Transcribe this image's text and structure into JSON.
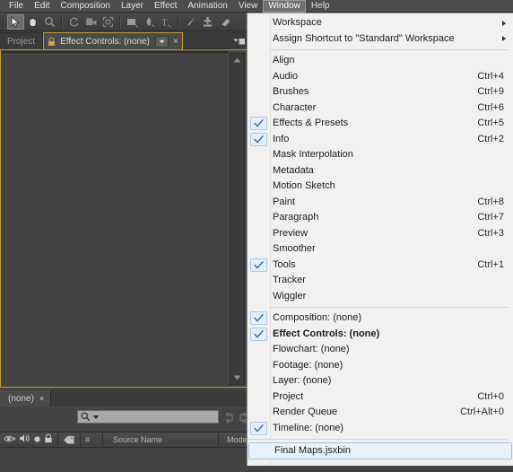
{
  "app": {
    "menubar": [
      {
        "label": "File",
        "active": false
      },
      {
        "label": "Edit",
        "active": false
      },
      {
        "label": "Composition",
        "active": false
      },
      {
        "label": "Layer",
        "active": false
      },
      {
        "label": "Effect",
        "active": false
      },
      {
        "label": "Animation",
        "active": false
      },
      {
        "label": "View",
        "active": false
      },
      {
        "label": "Window",
        "active": true
      },
      {
        "label": "Help",
        "active": false
      }
    ],
    "toolbar": {
      "tools": [
        {
          "name": "selection-tool",
          "selected": true
        },
        {
          "name": "hand-tool",
          "selected": false
        },
        {
          "name": "zoom-tool",
          "selected": false
        },
        {
          "name": "rotation-tool",
          "selected": false
        },
        {
          "name": "camera-tool",
          "selected": false
        },
        {
          "name": "pan-behind-tool",
          "selected": false
        },
        {
          "name": "shape-tool",
          "selected": false
        },
        {
          "name": "pen-tool",
          "selected": false
        },
        {
          "name": "text-tool",
          "selected": false
        },
        {
          "name": "brush-tool",
          "selected": false
        },
        {
          "name": "clone-stamp-tool",
          "selected": false
        },
        {
          "name": "eraser-tool",
          "selected": false
        }
      ]
    }
  },
  "panels": {
    "tabs": [
      {
        "label": "Project",
        "active": false
      },
      {
        "label": "Effect Controls: (none)",
        "active": true
      }
    ],
    "close_glyph": "×",
    "timeline": {
      "tab_label": "(none)",
      "search_value": "",
      "search_placeholder": "",
      "columns": [
        "Source Name",
        "Mode"
      ],
      "number_column": "#"
    }
  },
  "window_menu": {
    "groups": [
      {
        "items": [
          {
            "label": "Workspace",
            "shortcut": "",
            "checked": false,
            "submenu": true,
            "bold": false,
            "highlight": false
          },
          {
            "label": "Assign Shortcut to \"Standard\" Workspace",
            "shortcut": "",
            "checked": false,
            "submenu": true,
            "bold": false,
            "highlight": false
          }
        ]
      },
      {
        "items": [
          {
            "label": "Align",
            "shortcut": "",
            "checked": false,
            "submenu": false,
            "bold": false,
            "highlight": false
          },
          {
            "label": "Audio",
            "shortcut": "Ctrl+4",
            "checked": false,
            "submenu": false,
            "bold": false,
            "highlight": false
          },
          {
            "label": "Brushes",
            "shortcut": "Ctrl+9",
            "checked": false,
            "submenu": false,
            "bold": false,
            "highlight": false
          },
          {
            "label": "Character",
            "shortcut": "Ctrl+6",
            "checked": false,
            "submenu": false,
            "bold": false,
            "highlight": false
          },
          {
            "label": "Effects & Presets",
            "shortcut": "Ctrl+5",
            "checked": true,
            "submenu": false,
            "bold": false,
            "highlight": false
          },
          {
            "label": "Info",
            "shortcut": "Ctrl+2",
            "checked": true,
            "submenu": false,
            "bold": false,
            "highlight": false
          },
          {
            "label": "Mask Interpolation",
            "shortcut": "",
            "checked": false,
            "submenu": false,
            "bold": false,
            "highlight": false
          },
          {
            "label": "Metadata",
            "shortcut": "",
            "checked": false,
            "submenu": false,
            "bold": false,
            "highlight": false
          },
          {
            "label": "Motion Sketch",
            "shortcut": "",
            "checked": false,
            "submenu": false,
            "bold": false,
            "highlight": false
          },
          {
            "label": "Paint",
            "shortcut": "Ctrl+8",
            "checked": false,
            "submenu": false,
            "bold": false,
            "highlight": false
          },
          {
            "label": "Paragraph",
            "shortcut": "Ctrl+7",
            "checked": false,
            "submenu": false,
            "bold": false,
            "highlight": false
          },
          {
            "label": "Preview",
            "shortcut": "Ctrl+3",
            "checked": false,
            "submenu": false,
            "bold": false,
            "highlight": false
          },
          {
            "label": "Smoother",
            "shortcut": "",
            "checked": false,
            "submenu": false,
            "bold": false,
            "highlight": false
          },
          {
            "label": "Tools",
            "shortcut": "Ctrl+1",
            "checked": true,
            "submenu": false,
            "bold": false,
            "highlight": false
          },
          {
            "label": "Tracker",
            "shortcut": "",
            "checked": false,
            "submenu": false,
            "bold": false,
            "highlight": false
          },
          {
            "label": "Wiggler",
            "shortcut": "",
            "checked": false,
            "submenu": false,
            "bold": false,
            "highlight": false
          }
        ]
      },
      {
        "items": [
          {
            "label": "Composition: (none)",
            "shortcut": "",
            "checked": true,
            "submenu": false,
            "bold": false,
            "highlight": false
          },
          {
            "label": "Effect Controls: (none)",
            "shortcut": "",
            "checked": true,
            "submenu": false,
            "bold": true,
            "highlight": false
          },
          {
            "label": "Flowchart: (none)",
            "shortcut": "",
            "checked": false,
            "submenu": false,
            "bold": false,
            "highlight": false
          },
          {
            "label": "Footage: (none)",
            "shortcut": "",
            "checked": false,
            "submenu": false,
            "bold": false,
            "highlight": false
          },
          {
            "label": "Layer: (none)",
            "shortcut": "",
            "checked": false,
            "submenu": false,
            "bold": false,
            "highlight": false
          },
          {
            "label": "Project",
            "shortcut": "Ctrl+0",
            "checked": false,
            "submenu": false,
            "bold": false,
            "highlight": false
          },
          {
            "label": "Render Queue",
            "shortcut": "Ctrl+Alt+0",
            "checked": false,
            "submenu": false,
            "bold": false,
            "highlight": false
          },
          {
            "label": "Timeline: (none)",
            "shortcut": "",
            "checked": true,
            "submenu": false,
            "bold": false,
            "highlight": false
          }
        ]
      },
      {
        "items": [
          {
            "label": "Final Maps.jsxbin",
            "shortcut": "",
            "checked": false,
            "submenu": false,
            "bold": false,
            "highlight": true
          }
        ]
      }
    ]
  },
  "colors": {
    "accent_gold": "#c69a2a",
    "menu_bg": "#f2f1f0",
    "check_blue": "#2a5fa8",
    "highlight_bg": "#e9f2fb",
    "app_bg": "#434343"
  }
}
